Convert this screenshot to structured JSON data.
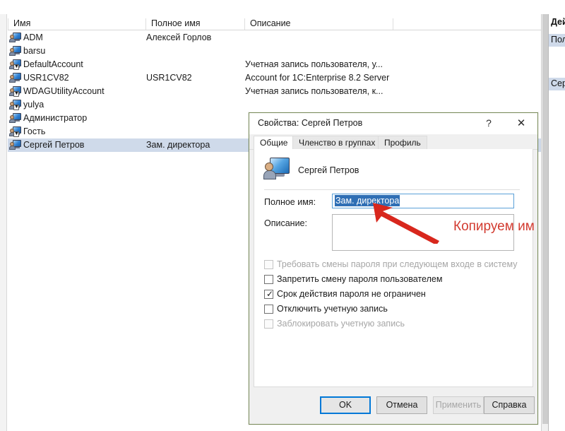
{
  "list": {
    "columns": [
      "Имя",
      "Полное имя",
      "Описание",
      ""
    ],
    "rows": [
      {
        "name": "ADM",
        "full": "Алексей Горлов",
        "desc": "",
        "disabled": false,
        "selected": false
      },
      {
        "name": "barsu",
        "full": "",
        "desc": "",
        "disabled": false,
        "selected": false
      },
      {
        "name": "DefaultAccount",
        "full": "",
        "desc": "Учетная запись пользователя, у...",
        "disabled": true,
        "selected": false
      },
      {
        "name": "USR1CV82",
        "full": "USR1CV82",
        "desc": "Account for 1C:Enterprise 8.2 Server",
        "disabled": false,
        "selected": false
      },
      {
        "name": "WDAGUtilityAccount",
        "full": "",
        "desc": "Учетная запись пользователя, к...",
        "disabled": true,
        "selected": false
      },
      {
        "name": "yulya",
        "full": "",
        "desc": "",
        "disabled": true,
        "selected": false
      },
      {
        "name": "Администратор",
        "full": "",
        "desc": "",
        "disabled": false,
        "selected": false
      },
      {
        "name": "Гость",
        "full": "",
        "desc": "",
        "disabled": true,
        "selected": false
      },
      {
        "name": "Сергей Петров",
        "full": "Зам. директора",
        "desc": "",
        "disabled": false,
        "selected": true
      }
    ]
  },
  "actions_pane": {
    "title": "Дей",
    "section_users": "Пол",
    "section_user": "Сер"
  },
  "dialog": {
    "title": "Свойства: Сергей Петров",
    "help_glyph": "?",
    "close_glyph": "✕",
    "tabs": [
      {
        "label": "Общие",
        "active": true
      },
      {
        "label": "Членство в группах",
        "active": false
      },
      {
        "label": "Профиль",
        "active": false
      }
    ],
    "user_name": "Сергей Петров",
    "fields": {
      "full_name_label": "Полное имя:",
      "full_name_value": "Зам. директора",
      "description_label": "Описание:",
      "description_value": ""
    },
    "checkboxes": [
      {
        "label": "Требовать смены пароля при следующем входе в систему",
        "checked": false,
        "enabled": false
      },
      {
        "label": "Запретить смену пароля пользователем",
        "checked": false,
        "enabled": true
      },
      {
        "label": "Срок действия пароля не ограничен",
        "checked": true,
        "enabled": true
      },
      {
        "label": "Отключить учетную запись",
        "checked": false,
        "enabled": true
      },
      {
        "label": "Заблокировать учетную запись",
        "checked": false,
        "enabled": false
      }
    ],
    "check_glyph": "✓",
    "buttons": {
      "ok": "OK",
      "cancel": "Отмена",
      "apply": "Применить",
      "help": "Справка"
    }
  },
  "annotation": {
    "text": "Копируем им",
    "color": "#d23b30"
  }
}
